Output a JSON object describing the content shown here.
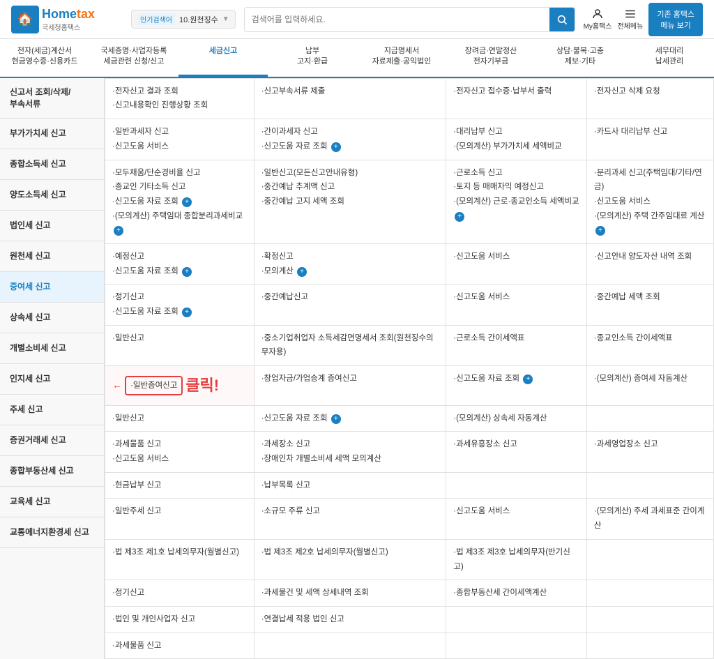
{
  "header": {
    "logo_home": "🏠",
    "logo_name": "Home",
    "logo_name2": "tax",
    "logo_subtitle": "국세청홈택스",
    "popular_label": "인기검색어",
    "popular_query": "10.원천징수",
    "search_placeholder": "검색어를 입력하세요.",
    "my_hometax": "My홈택스",
    "full_menu": "전체메뉴",
    "menu_view": "기존 홈택스\n메뉴 보기"
  },
  "topnav": [
    {
      "id": "receipts",
      "label": "전자(세금)계산서\n현금영수증·신용카드"
    },
    {
      "id": "registration",
      "label": "국세증명·사업자등록\n세금관련 신청/신고"
    },
    {
      "id": "tax_report",
      "label": "세금신고",
      "active": true
    },
    {
      "id": "payment",
      "label": "납부\n고지·환급"
    },
    {
      "id": "payment_statement",
      "label": "지급명세서\n자료제출·공익법인"
    },
    {
      "id": "year_end",
      "label": "장려금·연말정산\n전자기부금"
    },
    {
      "id": "consultation",
      "label": "상담·불복·고충\n제보·기타"
    },
    {
      "id": "agent",
      "label": "세무대리\n납세관리"
    }
  ],
  "categories": [
    {
      "id": "filing_manage",
      "label": "신고서 조회/삭제/\n부속서류"
    },
    {
      "id": "vat",
      "label": "부가가치세 신고"
    },
    {
      "id": "income",
      "label": "종합소득세 신고"
    },
    {
      "id": "transfer",
      "label": "양도소득세 신고"
    },
    {
      "id": "corporate",
      "label": "법인세 신고"
    },
    {
      "id": "withholding",
      "label": "원천세 신고"
    },
    {
      "id": "gift",
      "label": "증여세 신고",
      "highlighted": true
    },
    {
      "id": "inheritance",
      "label": "상속세 신고"
    },
    {
      "id": "consumption",
      "label": "개별소비세 신고"
    },
    {
      "id": "stamp",
      "label": "인지세 신고"
    },
    {
      "id": "liquor",
      "label": "주세 신고"
    },
    {
      "id": "securities",
      "label": "증권거래세 신고"
    },
    {
      "id": "real_estate",
      "label": "종합부동산세 신고"
    },
    {
      "id": "education",
      "label": "교육세 신고"
    },
    {
      "id": "traffic",
      "label": "교통에너지환경세 신고"
    }
  ],
  "table": {
    "rows": [
      {
        "id": "filing_manage",
        "col1": "·전자신고 결과 조회\n·신고내용확인 진행상황 조회",
        "col2": "·신고부속서류 제출",
        "col3": "·전자신고 접수증·납부서 출력",
        "col4": "·전자신고 삭제 요청"
      },
      {
        "id": "vat",
        "col1": "·일반과세자 신고\n·신고도움 서비스",
        "col2": "·간이과세자 신고\n·신고도움 자료 조회 ⊕",
        "col3": "·대리납부 신고\n·(모의계산) 부가가치세 세액비교",
        "col4": "·카드사 대리납부 신고"
      },
      {
        "id": "income",
        "col1": "·모두채움/단순경비율 신고\n·종교인 기타소득 신고\n·신고도움 자료 조회 ⊕\n·(모의계산) 주택임대 종합분리과세비교 ⊕",
        "col2": "·일반신고(모든신고안내유형)\n·중간예납 추계액 신고\n·중간예납 고지 세액 조회",
        "col3": "·근로소득 신고\n·토지 등 매매차익 예정신고\n·(모의계산) 근로·종교인소득 세액비교 ⊕",
        "col4": "·분리과세 신고(주택임대/기타/연금)\n·신고도움 서비스\n·(모의계산) 주택 간주임대료 계산 ⊕"
      },
      {
        "id": "transfer",
        "col1": "·예정신고\n·신고도움 자료 조회 ⊕",
        "col2": "·확정신고\n·모의계산 ⊕",
        "col3": "·신고도움 서비스",
        "col4": "·신고안내 양도자산 내역 조회"
      },
      {
        "id": "corporate",
        "col1": "·정기신고\n·신고도움 자료 조회 ⊕",
        "col2": "·중간예납신고",
        "col3": "·신고도움 서비스",
        "col4": "·중간예납 세액 조회"
      },
      {
        "id": "withholding",
        "col1": "·일반신고",
        "col2": "·중소기업취업자 소득세감면명세서 조회(원천징수의무자용)",
        "col3": "·근로소득 간이세액표",
        "col4": "·종교인소득 간이세액표"
      },
      {
        "id": "gift",
        "col1": "·일반증여신고",
        "col2": "·창업자금/가업승계 증여신고",
        "col3": "·신고도움 자료 조회 ⊕",
        "col4": "·(모의계산) 증여세 자동계산",
        "highlight_col1": true
      },
      {
        "id": "inheritance",
        "col1": "·일반신고",
        "col2": "·신고도움 자료 조회 ⊕",
        "col3": "·(모의계산) 상속세 자동계산",
        "col4": ""
      },
      {
        "id": "consumption",
        "col1": "·과세물품 신고\n·신고도움 서비스",
        "col2": "·과세장소 신고\n·장애인차 개별소비세 세액 모의계산",
        "col3": "·과세유흥장소 신고",
        "col4": "·과세영업장소 신고"
      },
      {
        "id": "stamp",
        "col1": "·현금납부 신고",
        "col2": "·납부목록 신고",
        "col3": "",
        "col4": ""
      },
      {
        "id": "liquor",
        "col1": "·일반주세 신고",
        "col2": "·소규모 주류 신고",
        "col3": "·신고도움 서비스",
        "col4": "·(모의계산) 주세 과세표준 간이계산"
      },
      {
        "id": "securities",
        "col1": "·법 제3조 제1호 납세의무자(월별신고)",
        "col2": "·법 제3조 제2호 납세의무자(월별신고)",
        "col3": "·법 제3조 제3호 납세의무자(반기신고)",
        "col4": ""
      },
      {
        "id": "real_estate",
        "col1": "·정기신고",
        "col2": "·과세물건 및 세액 상세내역 조회",
        "col3": "·종합부동산세 간이세액계산",
        "col4": ""
      },
      {
        "id": "education",
        "col1": "·법인 및 개인사업자 신고",
        "col2": "·연결납세 적용 법인 신고",
        "col3": "",
        "col4": ""
      },
      {
        "id": "traffic",
        "col1": "·과세물품 신고",
        "col2": "",
        "col3": "",
        "col4": ""
      }
    ]
  },
  "annotation": {
    "click_text": "클릭!",
    "arrow": "→"
  }
}
